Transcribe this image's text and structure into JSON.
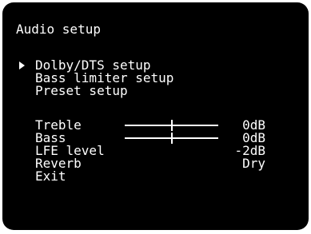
{
  "screen": {
    "title": "Audio setup"
  },
  "menu": {
    "items": [
      {
        "label": "Dolby/DTS setup",
        "selected": true
      },
      {
        "label": "Bass limiter setup",
        "selected": false
      },
      {
        "label": "Preset setup",
        "selected": false
      }
    ]
  },
  "settings": {
    "treble": {
      "label": "Treble",
      "value": "0dB",
      "level": 0.5
    },
    "bass": {
      "label": "Bass",
      "value": "0dB",
      "level": 0.5
    },
    "lfe": {
      "label": "LFE level",
      "value": "-2dB"
    },
    "reverb": {
      "label": "Reverb",
      "value": "Dry"
    },
    "exit": {
      "label": "Exit"
    }
  },
  "colors": {
    "background": "#000000",
    "text": "#ffffff"
  },
  "icons": {
    "cursor": "right-triangle-icon"
  }
}
